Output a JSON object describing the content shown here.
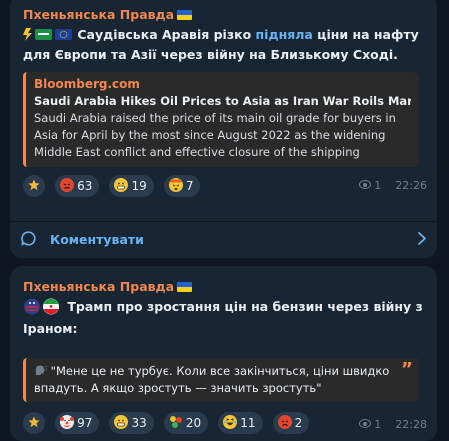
{
  "post1": {
    "channel": "Пхеньянська Правда",
    "text_before_link": " Саудівська Аравія різко ",
    "text_link": "підняла",
    "text_after_link": " ціни на нафту для Європи та Азії через війну на Близькому Сході.",
    "preview": {
      "site": "Bloomberg.com",
      "title": "Saudi Arabia Hikes Oil Prices to Asia as Iran War Roils Market",
      "body": "Saudi Arabia raised the price of its main oil grade for buyers in Asia for April by the most since August 2022 as the widening Middle East conflict and effective closure of the shipping chokepoint in the Strait of Hormuz roiled oil markets."
    },
    "reactions": [
      {
        "icon": "star-icon",
        "count": ""
      },
      {
        "icon": "angry-face-icon",
        "count": "63"
      },
      {
        "icon": "grinning-face-icon",
        "count": "19"
      },
      {
        "icon": "exploding-head-icon",
        "count": "7"
      }
    ],
    "views": "1",
    "time": "22:26",
    "comments_label": "Коментувати"
  },
  "post2": {
    "channel": "Пхеньянська Правда",
    "text": "Трамп про зростання цін на бензин через війну з Іраном:",
    "quote": "\"Мене це не турбує. Коли все закінчиться, ціни швидко впадуть. А якщо зростуть — значить зростуть\"",
    "reactions": [
      {
        "icon": "star-icon",
        "count": ""
      },
      {
        "icon": "clown-face-icon",
        "count": "97"
      },
      {
        "icon": "grinning-face-icon",
        "count": "33"
      },
      {
        "icon": "traffic-light-icon",
        "count": "20"
      },
      {
        "icon": "laughing-face-icon",
        "count": "11"
      },
      {
        "icon": "angry-face-icon",
        "count": "2"
      }
    ],
    "views": "1",
    "time": "22:28"
  },
  "colors": {
    "background": "#0e1621",
    "bubble": "#182533",
    "accent": "#f0884f",
    "link": "#6ab3f3"
  }
}
